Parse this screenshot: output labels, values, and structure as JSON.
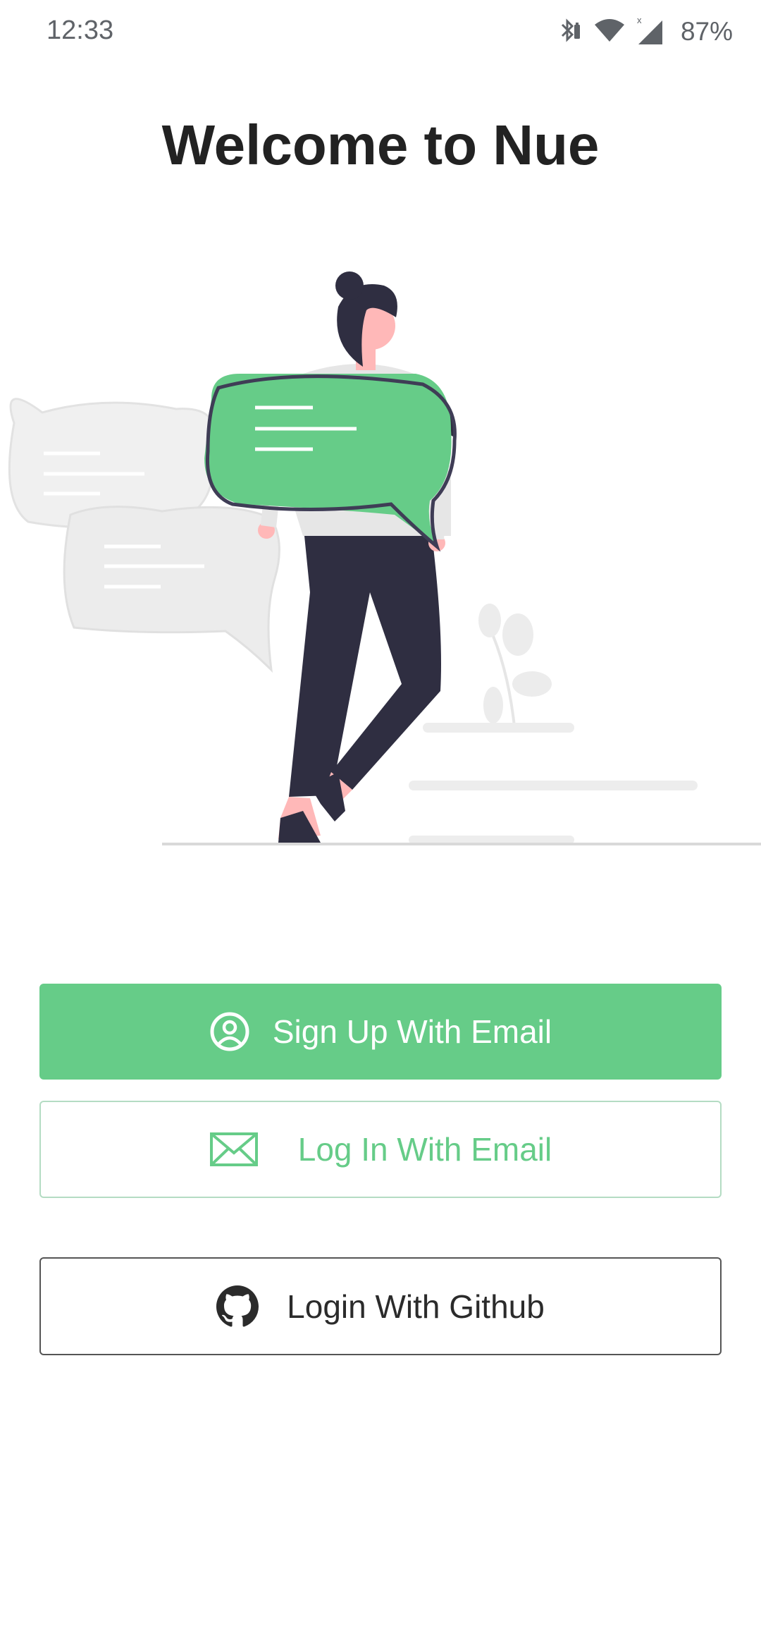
{
  "status_bar": {
    "time": "12:33",
    "battery_percent": "87%",
    "icons": [
      "bluetooth-icon",
      "wifi-icon",
      "cell-signal-icon",
      "battery-icon"
    ]
  },
  "header": {
    "title": "Welcome to Nue"
  },
  "buttons": {
    "signup_label": "Sign Up With Email",
    "login_label": "Log In With Email",
    "github_label": "Login With Github"
  },
  "colors": {
    "accent": "#66cc88",
    "title": "#222222",
    "dark": "#2f2e41",
    "skin": "#ffb8b8",
    "light_gray": "#f0f0f0"
  }
}
